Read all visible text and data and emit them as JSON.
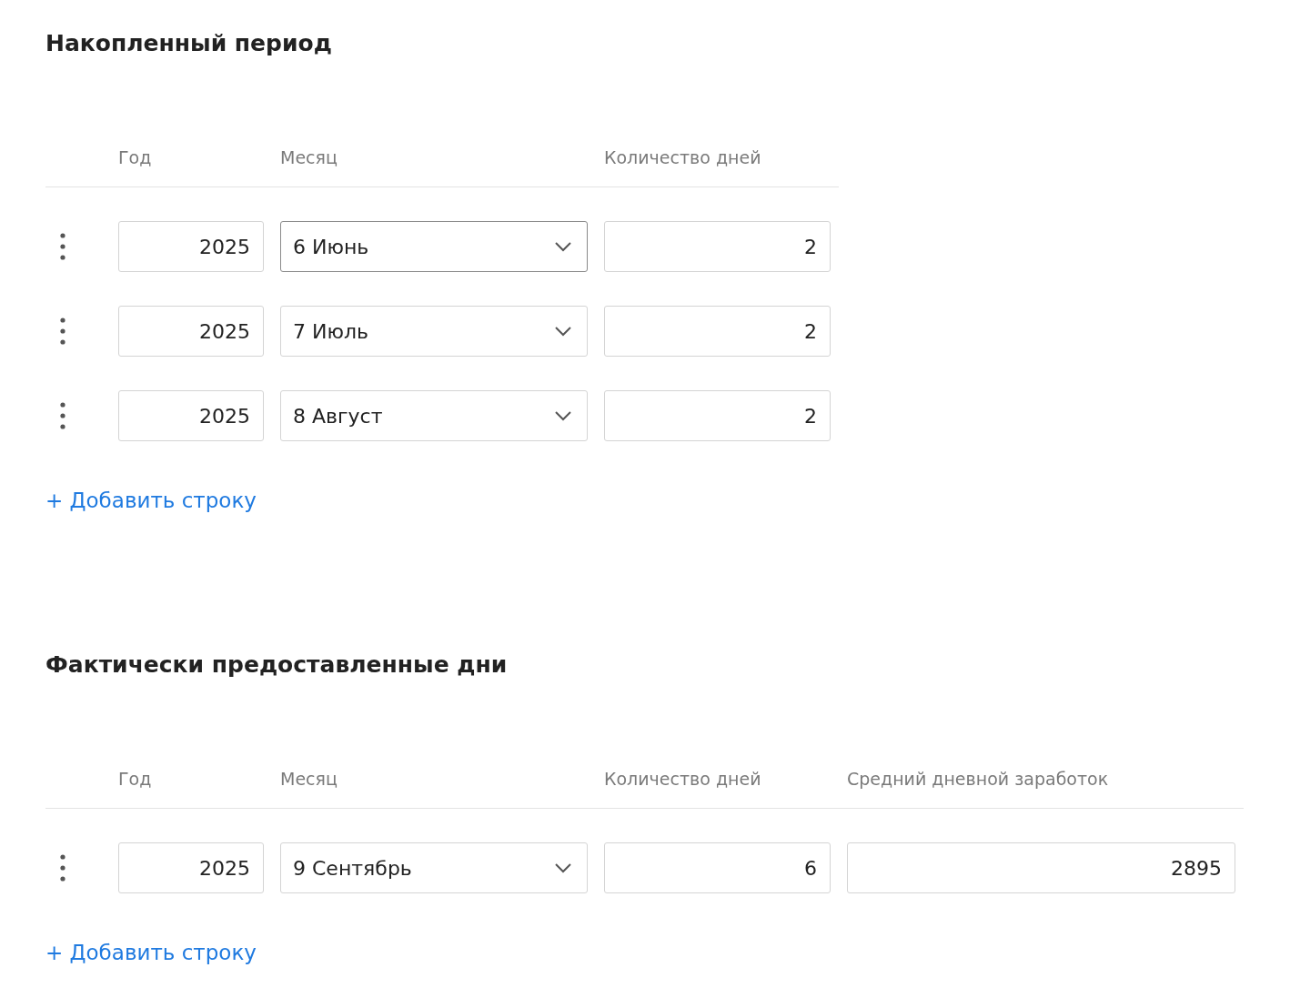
{
  "sections": [
    {
      "title": "Накопленный период",
      "columns": [
        "Год",
        "Месяц",
        "Количество дней"
      ],
      "rows": [
        {
          "cells": [
            {
              "kind": "input",
              "value": "2025"
            },
            {
              "kind": "select",
              "value": "6 Июнь",
              "focused": true
            },
            {
              "kind": "input",
              "value": "2"
            }
          ]
        },
        {
          "cells": [
            {
              "kind": "input",
              "value": "2025"
            },
            {
              "kind": "select",
              "value": "7 Июль",
              "focused": false
            },
            {
              "kind": "input",
              "value": "2"
            }
          ]
        },
        {
          "cells": [
            {
              "kind": "input",
              "value": "2025"
            },
            {
              "kind": "select",
              "value": "8 Август",
              "focused": false
            },
            {
              "kind": "input",
              "value": "2"
            }
          ]
        }
      ],
      "add_link": "+ Добавить строку"
    },
    {
      "title": "Фактически предоставленные дни",
      "columns": [
        "Год",
        "Месяц",
        "Количество дней",
        "Средний дневной заработок"
      ],
      "rows": [
        {
          "cells": [
            {
              "kind": "input",
              "value": "2025"
            },
            {
              "kind": "select",
              "value": "9 Сентябрь",
              "focused": false
            },
            {
              "kind": "input",
              "value": "6"
            },
            {
              "kind": "input",
              "value": "2895"
            }
          ]
        }
      ],
      "add_link": "+ Добавить строку"
    }
  ]
}
